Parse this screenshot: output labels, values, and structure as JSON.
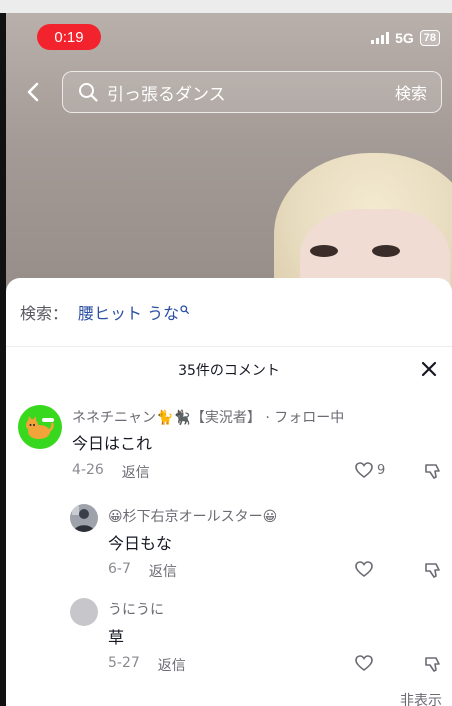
{
  "status_bar": {
    "record_time": "0:19",
    "network": "5G",
    "battery": "78"
  },
  "search": {
    "query": "引っ張るダンス",
    "submit_label": "検索"
  },
  "related_search": {
    "label": "検索：",
    "term": "腰ヒット うな"
  },
  "comments_panel": {
    "title": "35件のコメント",
    "hide_label": "非表示",
    "comments": [
      {
        "username": "ネネチニャン🐈🐈‍⬛【実況者】 · フォロー中",
        "text": "今日はこれ",
        "date": "4-26",
        "reply_label": "返信",
        "likes": "9"
      },
      {
        "username": "😀杉下右京オールスター😀",
        "text": "今日もな",
        "date": "6-7",
        "reply_label": "返信",
        "likes": ""
      },
      {
        "username": "うにうに",
        "text": "草",
        "date": "5-27",
        "reply_label": "返信",
        "likes": ""
      }
    ]
  }
}
